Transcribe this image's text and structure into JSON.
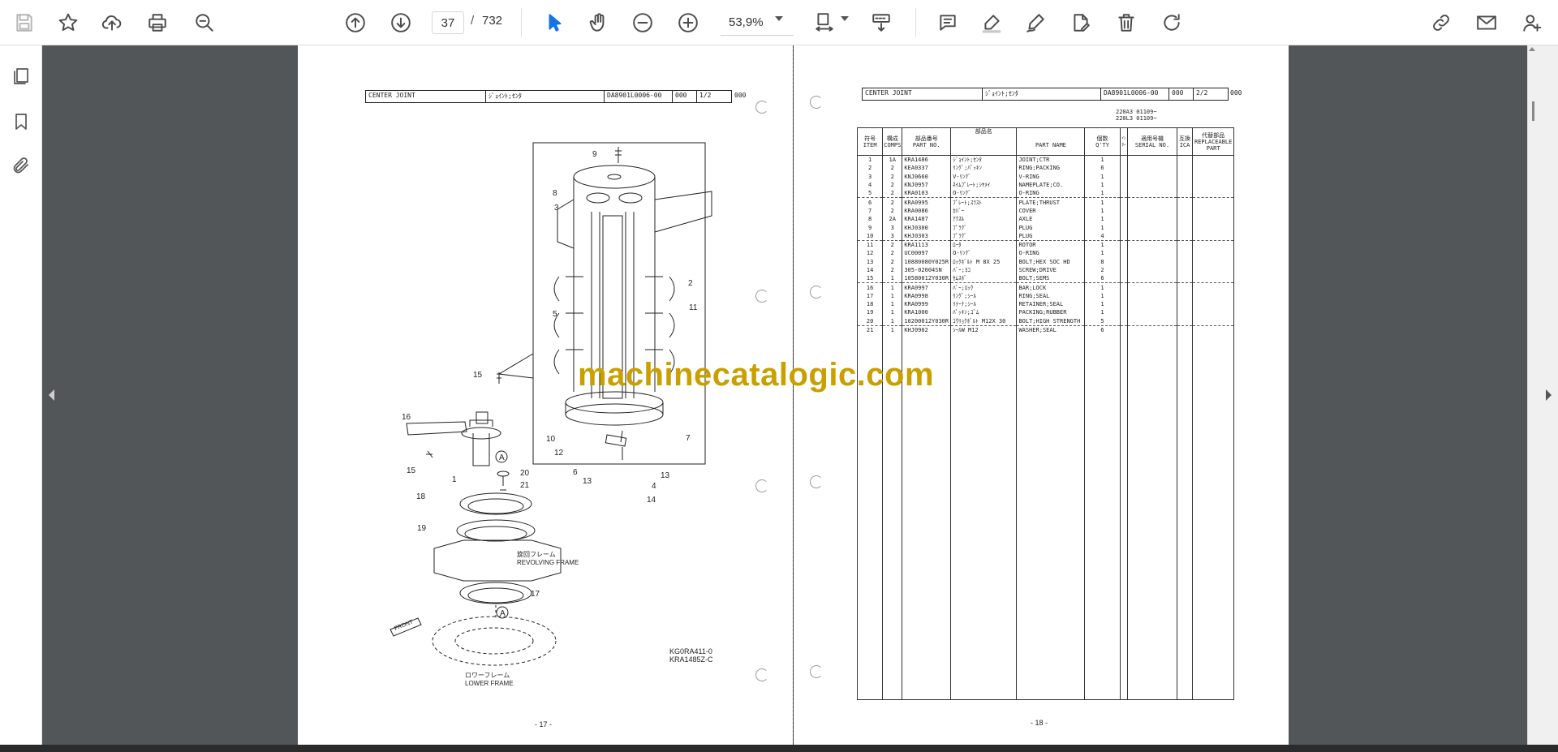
{
  "toolbar": {
    "page_current": "37",
    "page_separator": "/",
    "page_total": "732",
    "zoom": "53,9%"
  },
  "icons": [
    "save-icon",
    "bookmark-star-icon",
    "upload-cloud-icon",
    "print-icon",
    "zoom-search-icon",
    "previous-page-icon",
    "next-page-icon",
    "select-cursor-icon",
    "hand-tool-icon",
    "zoom-out-icon",
    "zoom-in-icon",
    "page-fit-icon",
    "scroll-mode-icon",
    "comment-icon",
    "highlight-icon",
    "draw-icon",
    "fill-sign-icon",
    "delete-icon",
    "rotate-icon",
    "share-link-icon",
    "email-icon",
    "add-user-icon",
    "pages-panel-icon",
    "bookmarks-panel-icon",
    "attachments-panel-icon"
  ],
  "colors": {
    "toolbar_bg": "#ffffff",
    "workspace_bg": "#525659",
    "select_tool_active": "#1473e6",
    "watermark": "#c9a000"
  },
  "left_page": {
    "header": [
      "CENTER JOINT",
      "ｼﾞｮｲﾝﾄ;ｾﾝﾀ",
      "DA8901L0006-00",
      "000",
      "1/2"
    ],
    "header_suffix": "000",
    "callouts": [
      "9",
      "8",
      "3",
      "2",
      "11",
      "5",
      "15",
      "16",
      "15",
      "1",
      "20",
      "21",
      "18",
      "19",
      "10",
      "12",
      "6",
      "13",
      "4",
      "13",
      "7",
      "14",
      "17"
    ],
    "markers": [
      "A",
      "A"
    ],
    "labels": {
      "revolving_jp": "旋回フレーム",
      "revolving_en": "REVOLVING FRAME",
      "lower_jp": "ロワーフレーム",
      "lower_en": "LOWER FRAME",
      "front": "FRONT"
    },
    "figure_codes": [
      "KG0RA411-0",
      "KRA1485Z-C"
    ],
    "page_number": "- 17 -"
  },
  "right_page": {
    "header": [
      "CENTER JOINT",
      "ｼﾞｮｲﾝﾄ;ｾﾝﾀ",
      "DA8901L0006-00",
      "000",
      "2/2"
    ],
    "header_suffix": "000",
    "model_refs": [
      "220A3 01109~",
      "220L3 01109~"
    ],
    "columns": [
      {
        "jp": "符号",
        "en": "ITEM"
      },
      {
        "jp": "構成",
        "en": "COMPS"
      },
      {
        "jp": "部品番号",
        "en": "PART NO."
      },
      {
        "jp": "部品名",
        "en": ""
      },
      {
        "jp": "",
        "en": "PART NAME"
      },
      {
        "jp": "個数",
        "en": "Q'TY"
      },
      {
        "jp": "ｲﾝﾀｰ",
        "en": ""
      },
      {
        "jp": "適用号機",
        "en": "SERIAL NO."
      },
      {
        "jp": "互換",
        "en": "ICA"
      },
      {
        "jp": "代替部品",
        "en": "REPLACEABLE PART"
      }
    ],
    "rows": [
      [
        "1",
        "1A",
        "KRA1486",
        "ｼﾞｮｲﾝﾄ;ｾﾝﾀ",
        "JOINT;CTR",
        "1"
      ],
      [
        "2",
        "2",
        "KEA0337",
        "ﾘﾝｸﾞ;ﾊﾟｯｷﾝ",
        "RING;PACKING",
        "6"
      ],
      [
        "3",
        "2",
        "KNJ0660",
        "V-ﾘﾝｸﾞ",
        "V-RING",
        "1"
      ],
      [
        "4",
        "2",
        "KNJ0957",
        "ﾈｲﾑﾌﾟﾚｰﾄ;ｼﾔﾒｲ",
        "NAMEPLATE;CO.",
        "1"
      ],
      [
        "5",
        "2",
        "KRA0103",
        "O-ﾘﾝｸﾞ",
        "O-RING",
        "1"
      ],
      [
        "6",
        "2",
        "KRA0995",
        "ﾌﾟﾚｰﾄ;ｽﾗｽﾄ",
        "PLATE;THRUST",
        "1"
      ],
      [
        "7",
        "2",
        "KRA0086",
        "ｶﾊﾞｰ",
        "COVER",
        "1"
      ],
      [
        "8",
        "2A",
        "KRA1487",
        "ｱｸｽﾙ",
        "AXLE",
        "1"
      ],
      [
        "9",
        "3",
        "KHJ0300",
        "ﾌﾟﾗｸﾞ",
        "PLUG",
        "1"
      ],
      [
        "10",
        "3",
        "KHJ0303",
        "ﾌﾟﾗｸﾞ",
        "PLUG",
        "4"
      ],
      [
        "11",
        "2",
        "KRA1113",
        "ﾛｰﾀ",
        "ROTOR",
        "1"
      ],
      [
        "12",
        "2",
        "UC00097",
        "O-ﾘﾝｸﾞ",
        "O-RING",
        "1"
      ],
      [
        "13",
        "2",
        "10880080Y025R",
        "ﾛｯｸﾎﾞﾙﾄ M 8X 25",
        "BOLT;HEX SOC HD",
        "8"
      ],
      [
        "14",
        "2",
        "305-02004SN",
        "ﾊﾞｰ;ﾖｺ",
        "SCREW;DRIVE",
        "2"
      ],
      [
        "15",
        "1",
        "10580012Y030R",
        "ｾﾑｽﾎﾞ",
        "BOLT;SEMS",
        "6"
      ],
      [
        "16",
        "1",
        "KRA0997",
        "ﾊﾞｰ;ﾛｯｸ",
        "BAR;LOCK",
        "1"
      ],
      [
        "17",
        "1",
        "KRA0998",
        "ﾘﾝｸﾞ;ｼｰﾙ",
        "RING;SEAL",
        "1"
      ],
      [
        "18",
        "1",
        "KRA0999",
        "ﾘﾃｰﾅ;ｼｰﾙ",
        "RETAINER;SEAL",
        "1"
      ],
      [
        "19",
        "1",
        "KRA1000",
        "ﾊﾟｯｷﾝ;ｺﾞﾑ",
        "PACKING;RUBBER",
        "1"
      ],
      [
        "20",
        "1",
        "10200012Y030R",
        "ｺｳﾘｮｸﾎﾞﾙﾄ M12X 30",
        "BOLT;HIGH STRENGTH",
        "5"
      ],
      [
        "21",
        "1",
        "KHJ0902",
        "ｼｰﾙW M12",
        "WASHER;SEAL",
        "6"
      ]
    ],
    "page_number": "- 18 -"
  },
  "watermark": "machinecatalogic.com"
}
